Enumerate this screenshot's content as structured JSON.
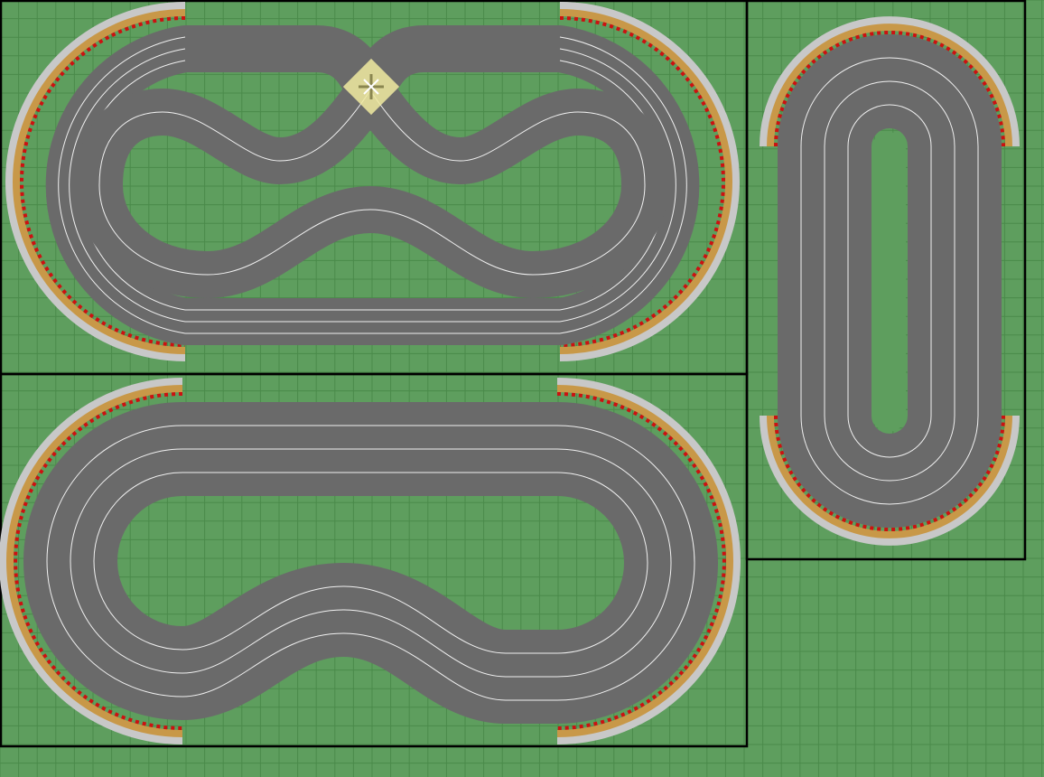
{
  "editor": {
    "background_color": "#5e9e5e",
    "grid_color": "#4a8a4a",
    "track_color": "#6a6a6a",
    "lane_line_color": "#ffffff",
    "gravel_color": "#c89848",
    "border_color": "#c8c8c8",
    "kerb_colors": [
      "#cc1111",
      "#ffffff"
    ],
    "crossover_color": "#f0eaa0"
  },
  "layouts": [
    {
      "id": "figure-eight-layout",
      "shape": "figure-eight with crossover",
      "lanes": 4
    },
    {
      "id": "kidney-layout",
      "shape": "oval with inner bend",
      "lanes": 4
    },
    {
      "id": "oval-layout",
      "shape": "vertical oval",
      "lanes": 4
    }
  ]
}
